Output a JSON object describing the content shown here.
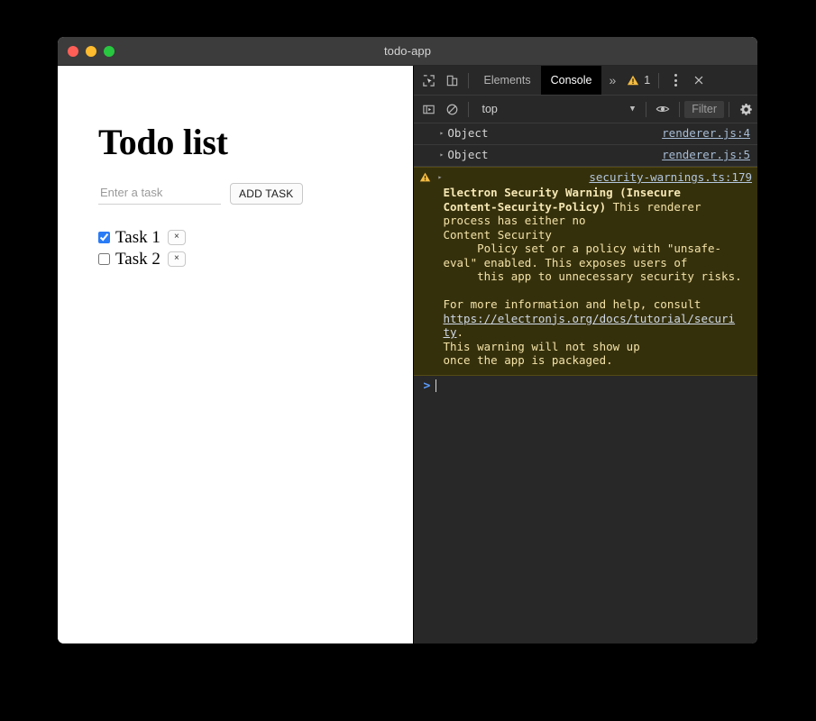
{
  "window": {
    "title": "todo-app",
    "traffic_lights": [
      {
        "name": "close",
        "color": "#ff5f57"
      },
      {
        "name": "minimize",
        "color": "#febc2e"
      },
      {
        "name": "zoom",
        "color": "#28c840"
      }
    ]
  },
  "app": {
    "heading": "Todo list",
    "input": {
      "value": "",
      "placeholder": "Enter a task"
    },
    "add_button": "ADD TASK",
    "tasks": [
      {
        "label": "Task 1",
        "checked": true,
        "delete_label": "×"
      },
      {
        "label": "Task 2",
        "checked": false,
        "delete_label": "×"
      }
    ]
  },
  "devtools": {
    "tabbar": {
      "inspect_icon": "inspect-element-icon",
      "device_icon": "device-toolbar-icon",
      "tabs": [
        {
          "label": "Elements",
          "active": false
        },
        {
          "label": "Console",
          "active": true
        }
      ],
      "overflow_label": "»",
      "warning_count": "1",
      "more_options_icon": "kebab-menu-icon",
      "close_label": "✕"
    },
    "filterbar": {
      "sidebar_icon": "console-sidebar-icon",
      "clear_icon": "clear-console-icon",
      "context": "top",
      "caret": "▼",
      "eye_icon": "live-expression-icon",
      "filter_placeholder": "Filter",
      "settings_icon": "gear-icon"
    },
    "console": {
      "logs": [
        {
          "expander": "▸",
          "text": "Object",
          "source": "renderer.js:4"
        },
        {
          "expander": "▸",
          "text": "Object",
          "source": "renderer.js:5"
        }
      ],
      "warning": {
        "icon": "warning-triangle-icon",
        "expander": "▸",
        "source": "security-warnings.ts:179",
        "title_line1": "Electron Security Warning (Insecure",
        "title_line2": "Content-Security-Policy)",
        "body_before_link": " This renderer process has either no\nContent Security\n     Policy set or a policy with \"unsafe-\neval\" enabled. This exposes users of\n     this app to unnecessary security risks.\n\nFor more information and help, consult\n",
        "link_text": "https://electronjs.org/docs/tutorial/securi\nty",
        "body_after_link": ".\nThis warning will not show up\nonce the app is packaged."
      },
      "prompt": {
        "caret": ">",
        "value": ""
      }
    }
  },
  "colors": {
    "accent_blue": "#2a7bf6",
    "warning_bg": "#35300c",
    "warning_text": "#f3e2a7",
    "devtools_bg": "#282828",
    "link": "#a7bdd6"
  }
}
